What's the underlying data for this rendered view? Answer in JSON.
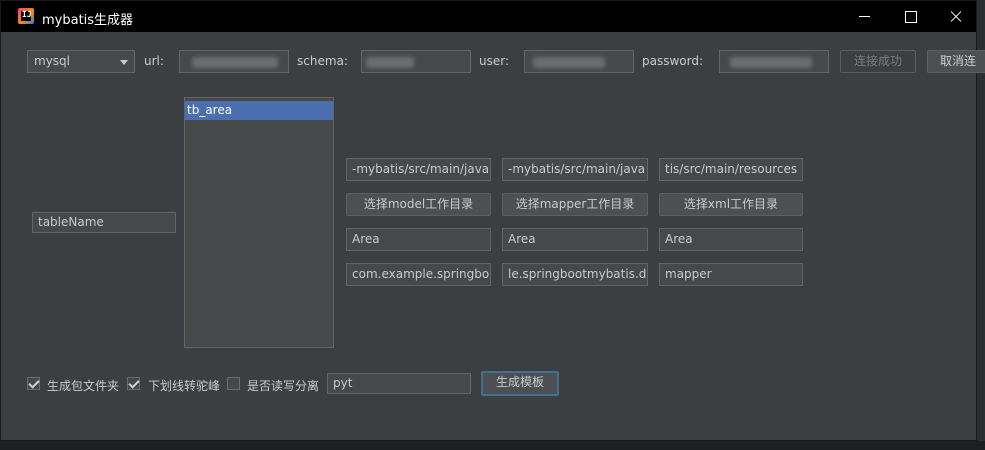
{
  "window": {
    "title": "mybatis生成器"
  },
  "connection": {
    "db_type": "mysql",
    "url_label": "url:",
    "schema_label": "schema:",
    "user_label": "user:",
    "password_label": "password:",
    "connect_button": "连接成功",
    "cancel_button": "取消连"
  },
  "tables": {
    "items": [
      "tb_area"
    ]
  },
  "table_name": {
    "value": "tableName"
  },
  "paths": {
    "model_path": "-mybatis/src/main/java",
    "mapper_path": "-mybatis/src/main/java",
    "xml_path": "tis/src/main/resources"
  },
  "buttons": {
    "select_model_dir": "选择model工作目录",
    "select_mapper_dir": "选择mapper工作目录",
    "select_xml_dir": "选择xml工作目录",
    "generate": "生成模板"
  },
  "names": {
    "model_name": "Area",
    "mapper_name": "Area",
    "xml_name": "Area"
  },
  "packages": {
    "model_package": "com.example.springbo",
    "mapper_package": "le.springbootmybatis.d",
    "xml_package": "mapper"
  },
  "options": {
    "gen_package_folder": {
      "label": "生成包文件夹",
      "checked": true
    },
    "camel_case": {
      "label": "下划线转驼峰",
      "checked": true
    },
    "rw_split": {
      "label": "是否读写分离",
      "checked": false
    },
    "prefix_value": "pyt"
  }
}
